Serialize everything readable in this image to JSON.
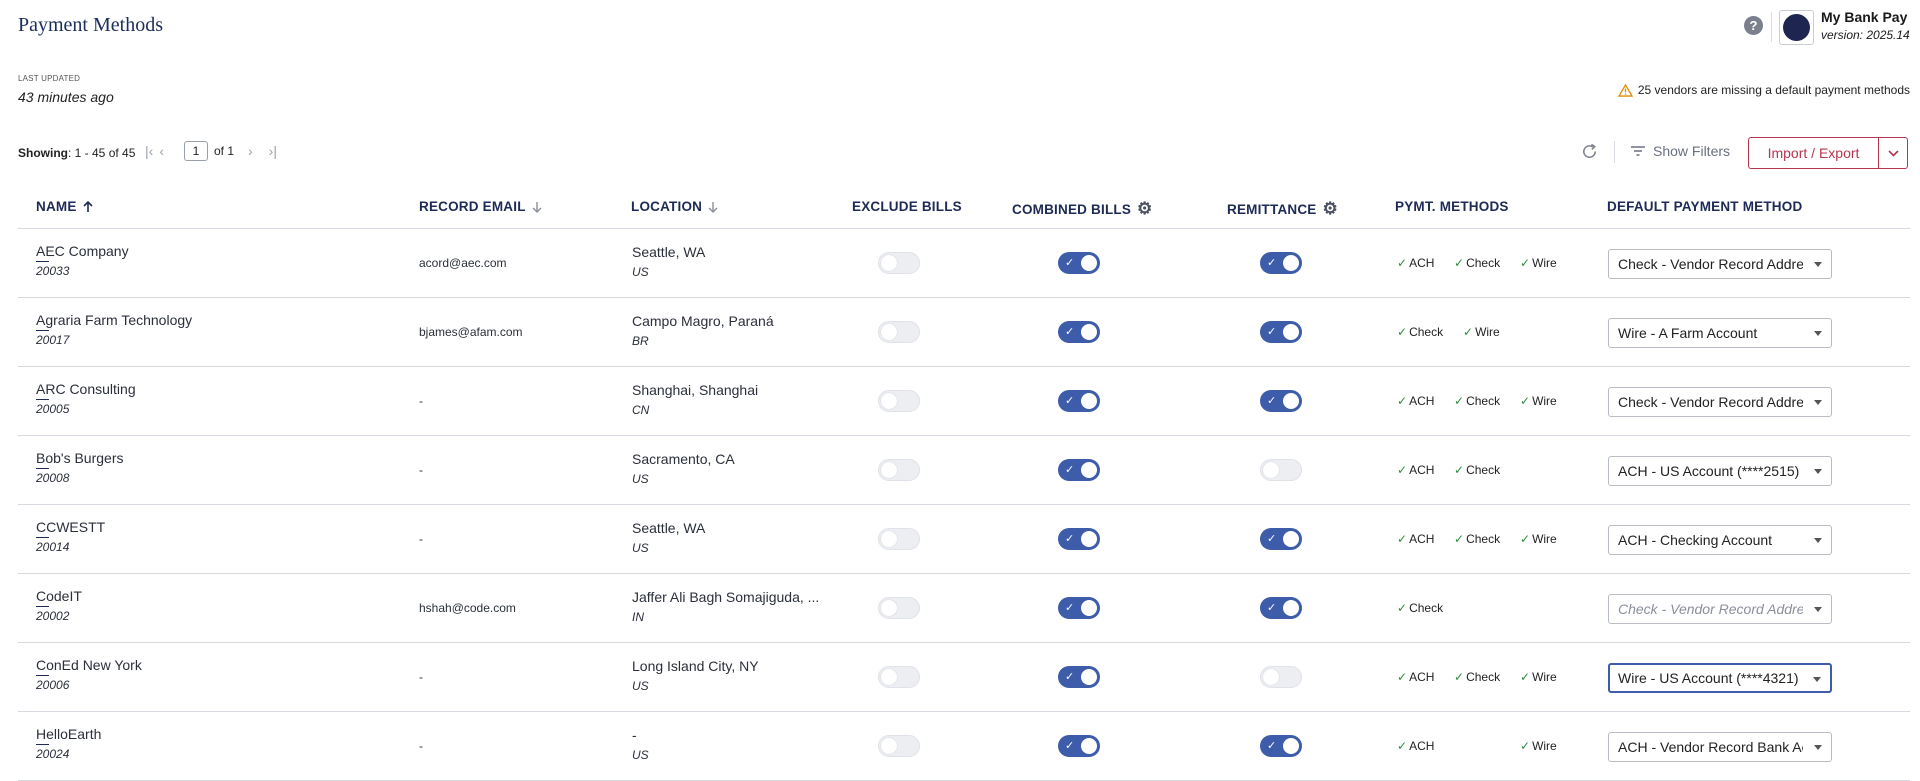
{
  "page": {
    "title": "Payment Methods",
    "last_updated_label": "LAST UPDATED",
    "last_updated_value": "43 minutes ago"
  },
  "header": {
    "help_icon": "question-circle-icon",
    "app_name": "My Bank Pay",
    "app_version": "version: 2025.14"
  },
  "warning": {
    "icon": "warning-triangle-icon",
    "text": "25 vendors are missing a default payment methods"
  },
  "pagination": {
    "showing_label": "Showing",
    "showing_range": ": 1 - 45 of 45",
    "page_value": "1",
    "page_of": "of 1"
  },
  "toolbar": {
    "refresh_icon": "refresh-icon",
    "show_filters_label": "Show Filters",
    "import_export_label": "Import / Export"
  },
  "columns": {
    "name": "NAME",
    "email": "RECORD EMAIL",
    "location": "LOCATION",
    "exclude": "EXCLUDE BILLS",
    "combined": "COMBINED BILLS",
    "remittance": "REMITTANCE",
    "methods": "PYMT. METHODS",
    "default": "DEFAULT PAYMENT METHOD"
  },
  "vendors": [
    {
      "name": "AEC Company",
      "id": "20033",
      "email": "acord@aec.com",
      "location": "Seattle, WA",
      "country": "US",
      "exclude": false,
      "combined": true,
      "remittance": true,
      "methods": [
        "ACH",
        "Check",
        "Wire"
      ],
      "default": "Check - Vendor Record Address",
      "default_state": "normal"
    },
    {
      "name": "Agraria Farm Technology",
      "id": "20017",
      "email": "bjames@afam.com",
      "location": "Campo Magro, Paraná",
      "country": "BR",
      "exclude": false,
      "combined": true,
      "remittance": true,
      "methods": [
        "Check",
        "Wire"
      ],
      "default": "Wire - A Farm Account",
      "default_state": "normal"
    },
    {
      "name": "ARC Consulting",
      "id": "20005",
      "email": "-",
      "location": "Shanghai, Shanghai",
      "country": "CN",
      "exclude": false,
      "combined": true,
      "remittance": true,
      "methods": [
        "ACH",
        "Check",
        "Wire"
      ],
      "default": "Check - Vendor Record Address",
      "default_state": "normal"
    },
    {
      "name": "Bob's Burgers",
      "id": "20008",
      "email": "-",
      "location": "Sacramento, CA",
      "country": "US",
      "exclude": false,
      "combined": true,
      "remittance": false,
      "methods": [
        "ACH",
        "Check"
      ],
      "default": "ACH - US Account (****2515)",
      "default_state": "normal"
    },
    {
      "name": "CCWESTT",
      "id": "20014",
      "email": "-",
      "location": "Seattle, WA",
      "country": "US",
      "exclude": false,
      "combined": true,
      "remittance": true,
      "methods": [
        "ACH",
        "Check",
        "Wire"
      ],
      "default": "ACH - Checking Account",
      "default_state": "normal"
    },
    {
      "name": "CodeIT",
      "id": "20002",
      "email": "hshah@code.com",
      "location": "Jaffer Ali Bagh Somajiguda, ...",
      "country": "IN",
      "exclude": false,
      "combined": true,
      "remittance": true,
      "methods": [
        "Check"
      ],
      "default": "Check - Vendor Record Address",
      "default_state": "muted"
    },
    {
      "name": "ConEd New York",
      "id": "20006",
      "email": "-",
      "location": "Long Island City, NY",
      "country": "US",
      "exclude": false,
      "combined": true,
      "remittance": false,
      "methods": [
        "ACH",
        "Check",
        "Wire"
      ],
      "default": "Wire - US Account (****4321)",
      "default_state": "focused"
    },
    {
      "name": "HelloEarth",
      "id": "20024",
      "email": "-",
      "location": "-",
      "country": "US",
      "exclude": false,
      "combined": true,
      "remittance": true,
      "methods": [
        "ACH",
        "Wire"
      ],
      "default": "ACH - Vendor Record Bank Account",
      "default_state": "normal"
    }
  ]
}
